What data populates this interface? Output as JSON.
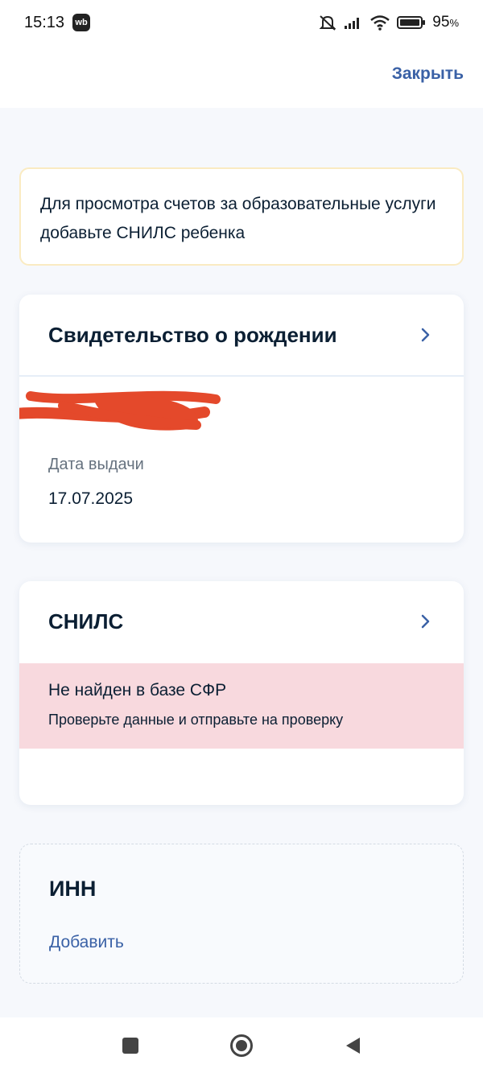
{
  "status_bar": {
    "time": "15:13",
    "app_badge": "wb",
    "battery_percent": "95",
    "battery_unit": "%"
  },
  "top_bar": {
    "close_label": "Закрыть"
  },
  "notice": {
    "text": "Для просмотра счетов за образовательные услуги добавьте СНИЛС ребенка"
  },
  "birth_certificate": {
    "title": "Свидетельство о рождении",
    "issue_date_label": "Дата выдачи",
    "issue_date_value": "17.07.2025"
  },
  "snils": {
    "title": "СНИЛС",
    "error_title": "Не найден в базе СФР",
    "error_subtitle": "Проверьте данные и отправьте на проверку"
  },
  "inn": {
    "title": "ИНН",
    "add_label": "Добавить"
  },
  "colors": {
    "accent": "#3a61a6",
    "error_bg": "#f8d9de",
    "notice_border": "#faebc2",
    "redaction": "#e4492b"
  },
  "icons": {
    "card_chevron": "chevron-right-icon",
    "nav_recents": "square-icon",
    "nav_home": "circle-icon",
    "nav_back": "triangle-left-icon"
  }
}
